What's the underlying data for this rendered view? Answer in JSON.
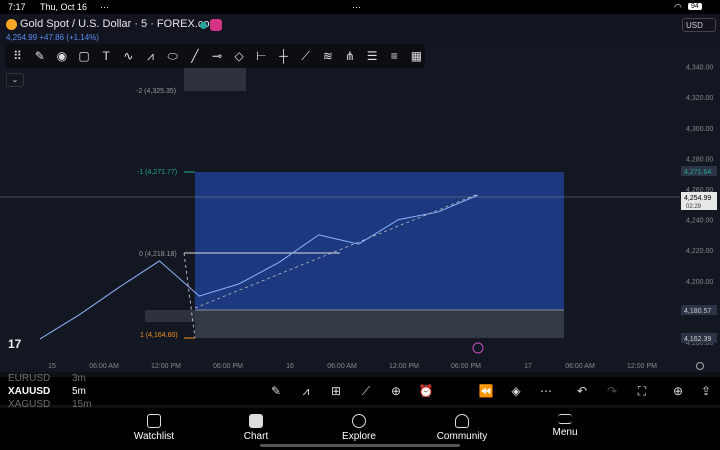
{
  "status_bar": {
    "time": "7:17",
    "date": "Thu, Oct 16",
    "dots_left": "···",
    "dots_center": "···",
    "battery": "94"
  },
  "header": {
    "symbol_title": "Gold Spot / U.S. Dollar · 5 · FOREX.com",
    "price_line": "4,254.99 +47.86 (+1.14%)",
    "currency": "USD"
  },
  "price_axis": {
    "ticks": [
      "4,360.00",
      "4,340.00",
      "4,320.00",
      "4,300.00",
      "4,280.00",
      "4,260.00",
      "4,240.00",
      "4,220.00",
      "4,200.00",
      "4,180.00",
      "4,160.00"
    ],
    "current_price": "4,254.99",
    "countdown": "02:29",
    "label_upper": "4,271.64",
    "label_mid": "4,180.57",
    "label_low": "4,162.39"
  },
  "fib_labels": {
    "minus2": "-2 (4,325.35)",
    "minus1": "-1 (4,271.77)",
    "zero": "0 (4,218.18)",
    "one": "1 (4,164.60)"
  },
  "time_axis": [
    "15",
    "06:00 AM",
    "12:00 PM",
    "06:00 PM",
    "16",
    "06:00 AM",
    "12:00 PM",
    "06:00 PM",
    "17",
    "06:00 AM",
    "12:00 PM"
  ],
  "chart_data": {
    "type": "line",
    "title": "Gold Spot / U.S. Dollar · 5 · FOREX.com",
    "xlabel": "",
    "ylabel": "",
    "ylim": [
      4150,
      4365
    ],
    "x": [
      "15 00:00",
      "15 06:00",
      "15 12:00",
      "15 15:00",
      "15 18:00",
      "16 00:00",
      "16 06:00",
      "16 09:00",
      "16 12:00",
      "16 15:00",
      "16 18:00",
      "16 20:00"
    ],
    "series": [
      {
        "values": [
          4162,
          4178,
          4196,
          4213,
          4190,
          4198,
          4212,
          4230,
          4224,
          4240,
          4245,
          4256
        ]
      }
    ]
  },
  "bottom_toolbar": {
    "symbols": [
      "EURUSD",
      "XAUUSD",
      "XAGUSD"
    ],
    "intervals": [
      "3m",
      "5m",
      "15m"
    ],
    "tool_icons": [
      "pencil-icon",
      "chart-type-icon",
      "indicators-icon",
      "compare-icon",
      "add-icon",
      "alert-icon",
      "replay-icon",
      "layers-icon",
      "more-icon",
      "undo-icon",
      "redo-icon",
      "fullscreen-icon",
      "idea-icon",
      "share-icon"
    ]
  },
  "nav": {
    "items": [
      {
        "label": "Watchlist",
        "icon": "list-icon"
      },
      {
        "label": "Chart",
        "icon": "chart-icon"
      },
      {
        "label": "Explore",
        "icon": "compass-icon"
      },
      {
        "label": "Community",
        "icon": "people-icon"
      },
      {
        "label": "Menu",
        "icon": "menu-icon"
      }
    ]
  },
  "colors": {
    "accent": "#2962ff",
    "up": "#26a69a",
    "down": "#ef5350",
    "fib_box": "#1e3a8a",
    "orange": "#f7931a"
  }
}
